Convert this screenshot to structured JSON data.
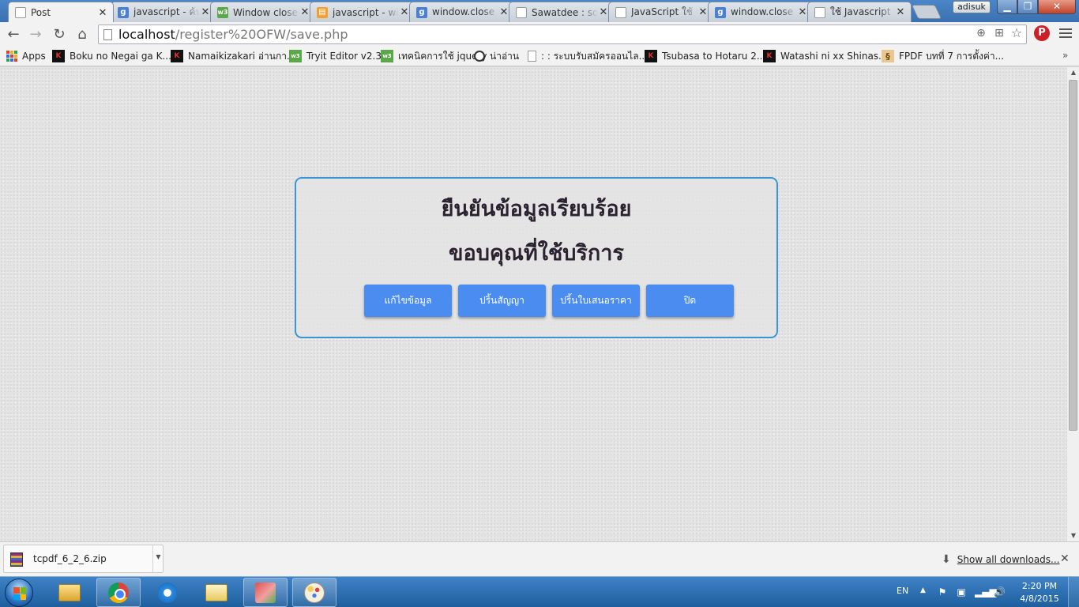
{
  "browser": {
    "tabs": [
      {
        "title": "Post",
        "icon": "page-icon",
        "active": true
      },
      {
        "title": "javascript - ค้นหาด้วย Google",
        "icon": "google-icon"
      },
      {
        "title": "Window close() Method",
        "icon": "w3schools-icon"
      },
      {
        "title": "javascript - window.close()",
        "icon": "stackoverflow-icon"
      },
      {
        "title": "window.close - ค้นหาด้วย Google",
        "icon": "google-icon"
      },
      {
        "title": "Sawatdee : sourcecode",
        "icon": "page-icon"
      },
      {
        "title": "JavaScript ใช้ window.close",
        "icon": "page-icon"
      },
      {
        "title": "window.close - ค้นหาด้วย Google",
        "icon": "google-icon"
      },
      {
        "title": "ใช้ Javascript ปิดหน้าต่าง",
        "icon": "page-icon"
      }
    ],
    "profile_name": "adisuk",
    "address": {
      "host": "localhost",
      "path": "/register%20OFW/save.php"
    },
    "bookmarks": [
      {
        "label": "Apps",
        "icon": "apps-grid-icon"
      },
      {
        "label": "Boku no Negai ga K...",
        "icon": "kissmanga-icon"
      },
      {
        "label": "Namaikizakari อ่านกา...",
        "icon": "kissmanga-icon"
      },
      {
        "label": "Tryit Editor v2.3",
        "icon": "w3schools-icon"
      },
      {
        "label": "เทคนิคการใช้ jquery",
        "icon": "w3schools-icon"
      },
      {
        "label": "น่าอ่าน",
        "icon": "folder-black-icon"
      },
      {
        "label": ": : ระบบรับสมัครออนไล...",
        "icon": "page-icon"
      },
      {
        "label": "Tsubasa to Hotaru 2...",
        "icon": "kissmanga-icon"
      },
      {
        "label": "Watashi ni xx Shinas...",
        "icon": "kissmanga-icon"
      },
      {
        "label": "FPDF บทที่ 7 การตั้งค่า...",
        "icon": "fpdf-icon"
      }
    ],
    "bookmarks_more": "»"
  },
  "page": {
    "heading_line1": "ยืนยันข้อมูลเรียบร้อย",
    "heading_line2": "ขอบคุณที่ใช้บริการ",
    "buttons": {
      "edit": "แก้ไขข้อมูล",
      "print_contract": "ปริ้นสัญญา",
      "print_quote": "ปริ้นใบเสนอราคา",
      "close": "ปิด"
    },
    "accent_color": "#3a95d4",
    "button_color": "#4a8cf0"
  },
  "downloads": {
    "item_name": "tcpdf_6_2_6.zip",
    "show_all_label": "Show all downloads..."
  },
  "taskbar": {
    "language": "EN",
    "time": "2:20 PM",
    "date": "4/8/2015",
    "apps": [
      "explorer-icon",
      "chrome-icon",
      "ie-icon",
      "mail-icon",
      "app-icon",
      "paint-icon"
    ]
  }
}
